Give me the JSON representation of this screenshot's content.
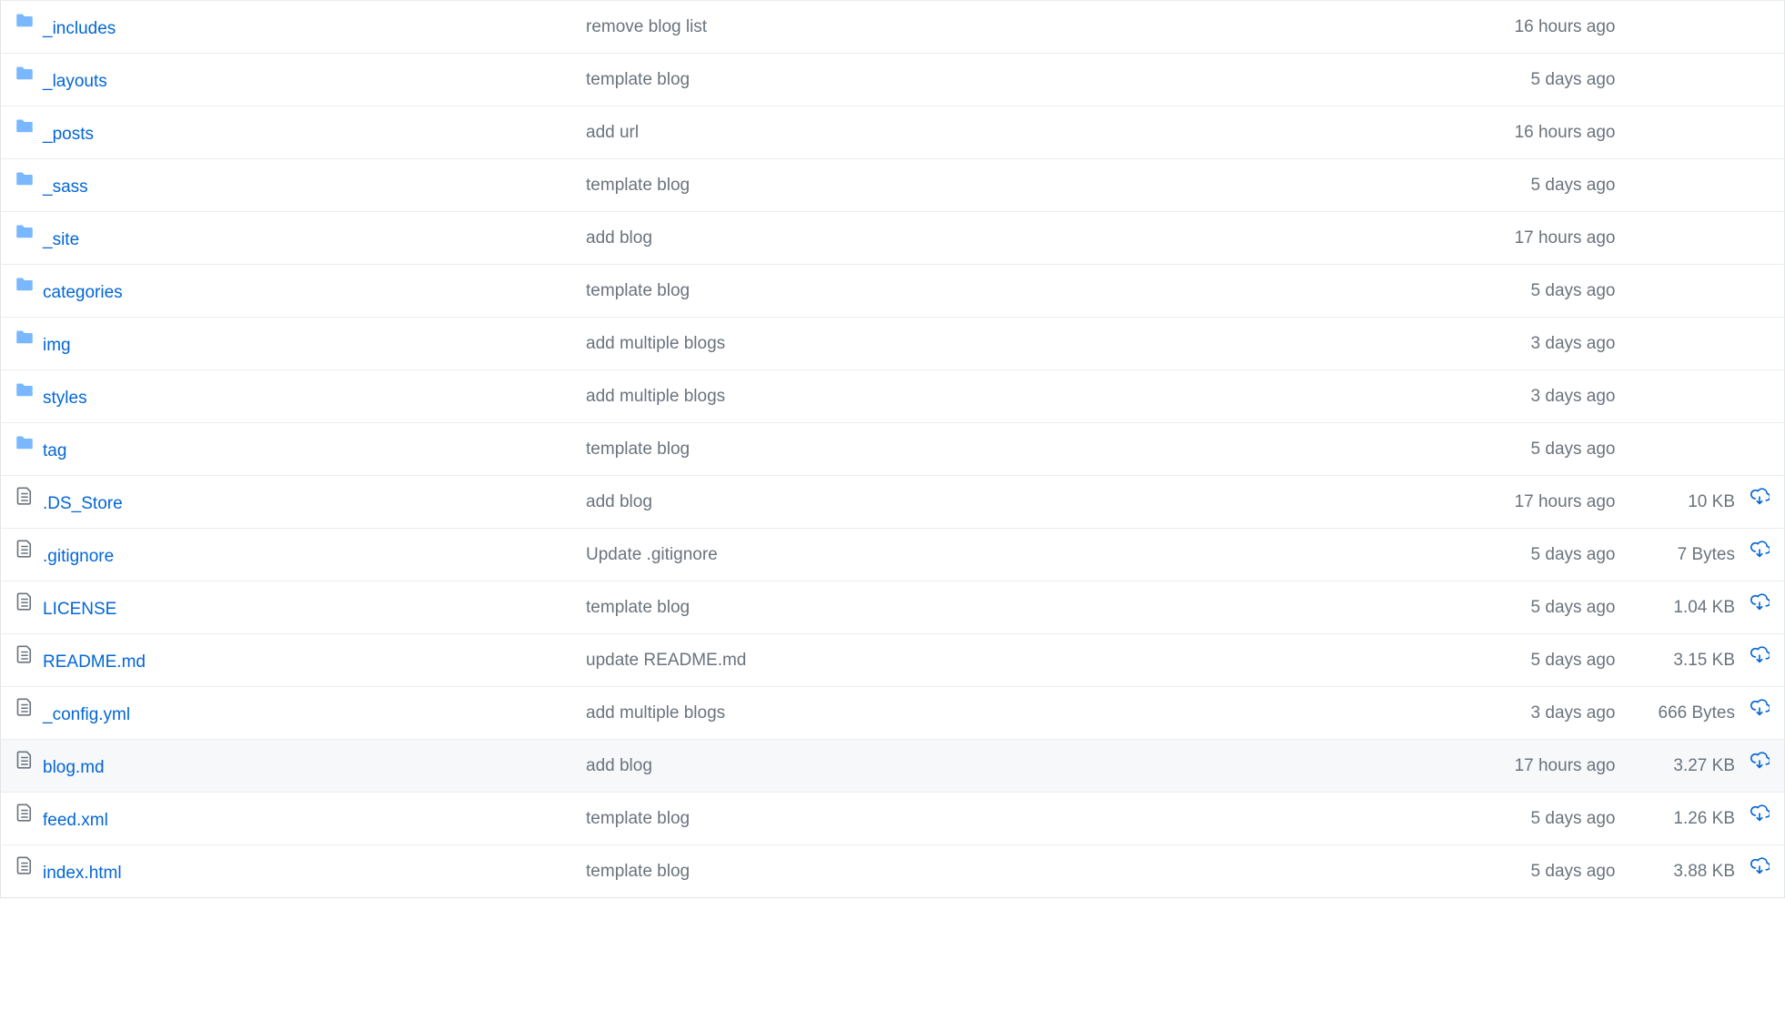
{
  "files": [
    {
      "type": "folder",
      "name": "_includes",
      "message": "remove blog list",
      "time": "16 hours ago",
      "size": "",
      "download": false,
      "highlight": false
    },
    {
      "type": "folder",
      "name": "_layouts",
      "message": "template blog",
      "time": "5 days ago",
      "size": "",
      "download": false,
      "highlight": false
    },
    {
      "type": "folder",
      "name": "_posts",
      "message": "add url",
      "time": "16 hours ago",
      "size": "",
      "download": false,
      "highlight": false
    },
    {
      "type": "folder",
      "name": "_sass",
      "message": "template blog",
      "time": "5 days ago",
      "size": "",
      "download": false,
      "highlight": false
    },
    {
      "type": "folder",
      "name": "_site",
      "message": "add blog",
      "time": "17 hours ago",
      "size": "",
      "download": false,
      "highlight": false
    },
    {
      "type": "folder",
      "name": "categories",
      "message": "template blog",
      "time": "5 days ago",
      "size": "",
      "download": false,
      "highlight": false
    },
    {
      "type": "folder",
      "name": "img",
      "message": "add multiple blogs",
      "time": "3 days ago",
      "size": "",
      "download": false,
      "highlight": false
    },
    {
      "type": "folder",
      "name": "styles",
      "message": "add multiple blogs",
      "time": "3 days ago",
      "size": "",
      "download": false,
      "highlight": false
    },
    {
      "type": "folder",
      "name": "tag",
      "message": "template blog",
      "time": "5 days ago",
      "size": "",
      "download": false,
      "highlight": false
    },
    {
      "type": "file",
      "name": ".DS_Store",
      "message": "add blog",
      "time": "17 hours ago",
      "size": "10 KB",
      "download": true,
      "highlight": false
    },
    {
      "type": "file",
      "name": ".gitignore",
      "message": "Update .gitignore",
      "time": "5 days ago",
      "size": "7 Bytes",
      "download": true,
      "highlight": false
    },
    {
      "type": "file",
      "name": "LICENSE",
      "message": "template blog",
      "time": "5 days ago",
      "size": "1.04 KB",
      "download": true,
      "highlight": false
    },
    {
      "type": "file",
      "name": "README.md",
      "message": "update README.md",
      "time": "5 days ago",
      "size": "3.15 KB",
      "download": true,
      "highlight": false
    },
    {
      "type": "file",
      "name": "_config.yml",
      "message": "add multiple blogs",
      "time": "3 days ago",
      "size": "666 Bytes",
      "download": true,
      "highlight": false
    },
    {
      "type": "file",
      "name": "blog.md",
      "message": "add blog",
      "time": "17 hours ago",
      "size": "3.27 KB",
      "download": true,
      "highlight": true
    },
    {
      "type": "file",
      "name": "feed.xml",
      "message": "template blog",
      "time": "5 days ago",
      "size": "1.26 KB",
      "download": true,
      "highlight": false
    },
    {
      "type": "file",
      "name": "index.html",
      "message": "template blog",
      "time": "5 days ago",
      "size": "3.88 KB",
      "download": true,
      "highlight": false
    }
  ]
}
